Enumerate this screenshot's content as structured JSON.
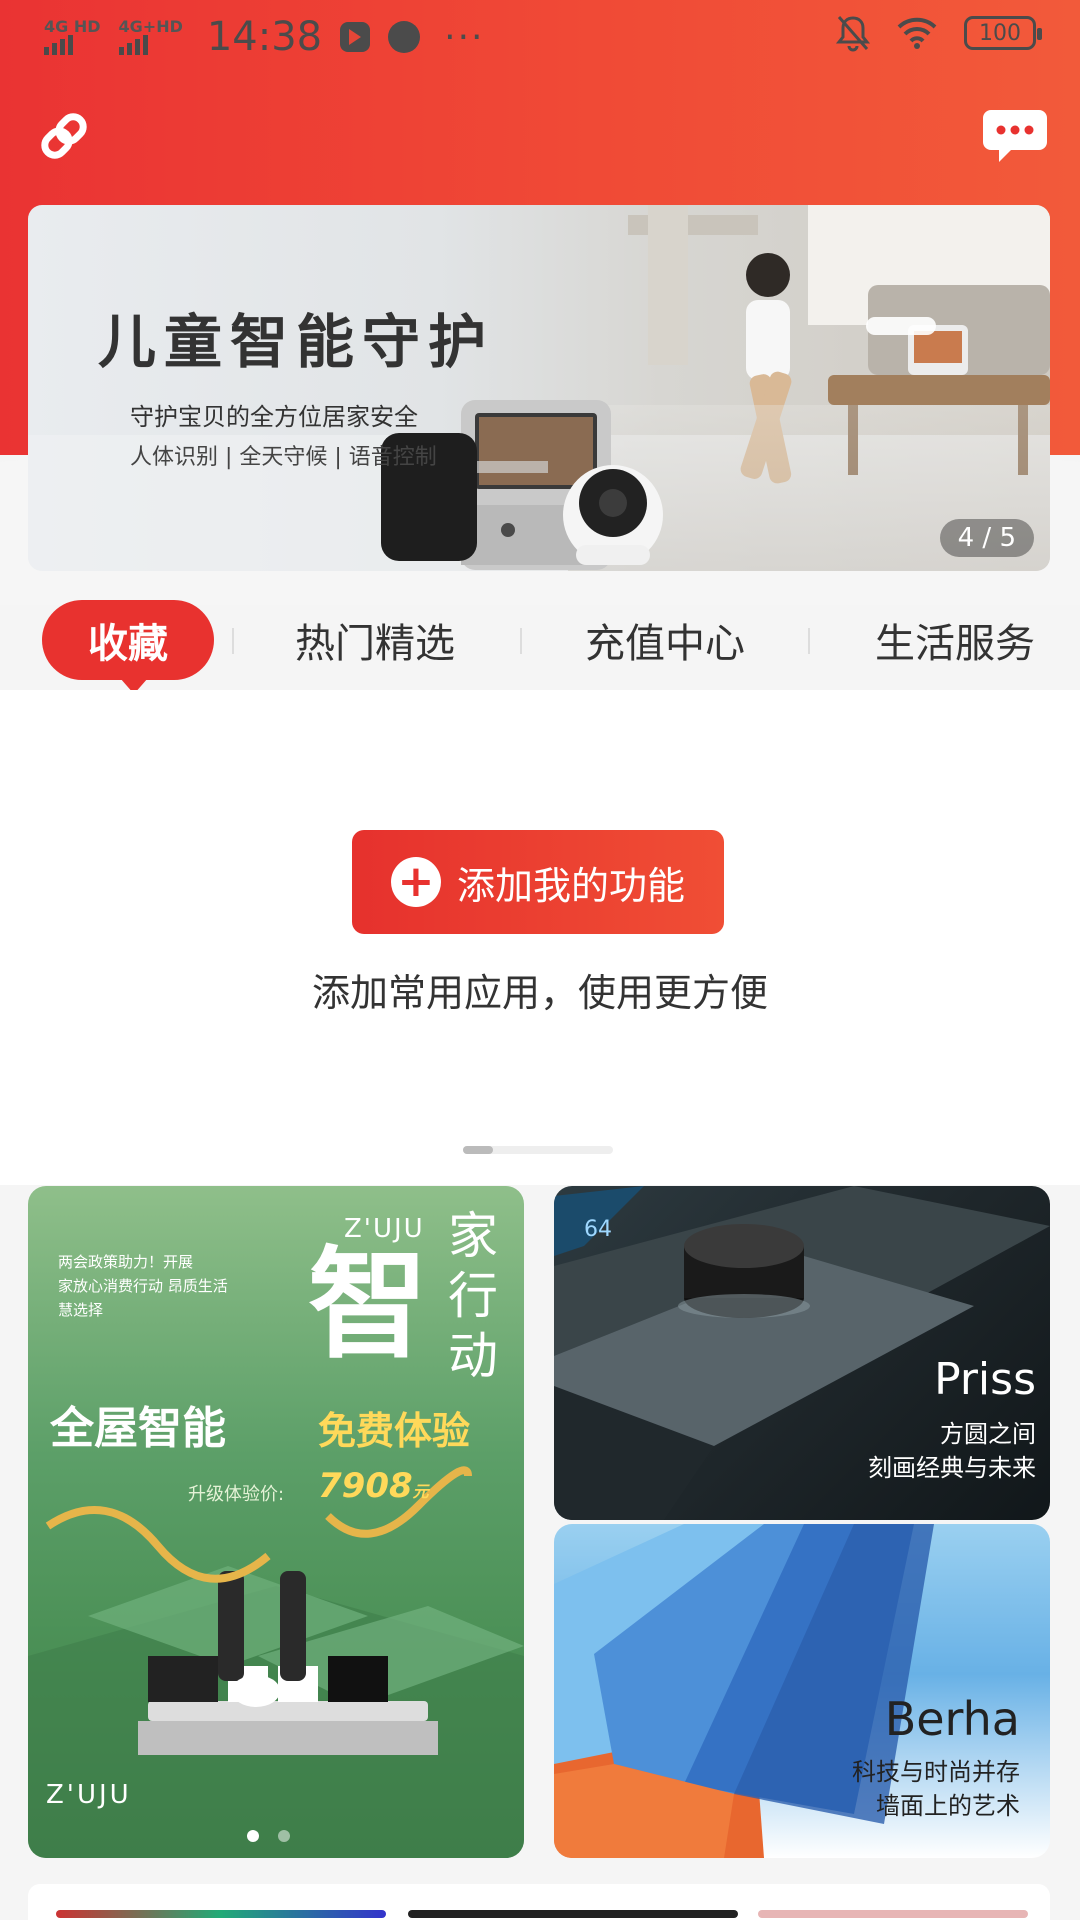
{
  "status_bar": {
    "time": "14:38",
    "signal1_label": "4G HD",
    "signal2_label": "4G+HD",
    "overflow_dots": "···",
    "battery": "100"
  },
  "header": {
    "link_icon": "link-icon",
    "message_icon": "message-icon"
  },
  "banner": {
    "title": "儿童智能守护",
    "subtitle": "守护宝贝的全方位居家安全",
    "features": "人体识别 | 全天守候 | 语音控制",
    "pager": "4 / 5"
  },
  "tabs": [
    {
      "label": "收藏",
      "active": true
    },
    {
      "label": "热门精选",
      "active": false
    },
    {
      "label": "充值中心",
      "active": false
    },
    {
      "label": "生活服务",
      "active": false
    }
  ],
  "favorites": {
    "add_button": "添加我的功能",
    "hint": "添加常用应用，使用更方便"
  },
  "cards": {
    "zuju": {
      "brand": "Z'UJU",
      "headline_chars": [
        "家",
        "行",
        "动"
      ],
      "big_char": "智",
      "intro_line1": "两会政策助力！开展",
      "intro_line2": "家放心消费行动 昂质生活",
      "intro_line3": "慧选择",
      "slogan_a": "全屋智能",
      "slogan_b": "免费体验",
      "price_label": "升级体验价:",
      "price": "7908",
      "price_unit": "元",
      "footer_brand": "Z'UJU"
    },
    "priss": {
      "title": "Priss",
      "line1": "方圆之间",
      "line2": "刻画经典与未来"
    },
    "berha": {
      "title": "Berha",
      "line1": "科技与时尚并存",
      "line2": "墙面上的艺术"
    }
  },
  "colors": {
    "accent": "#e8322f",
    "header_gradient_end": "#f25a3a"
  }
}
